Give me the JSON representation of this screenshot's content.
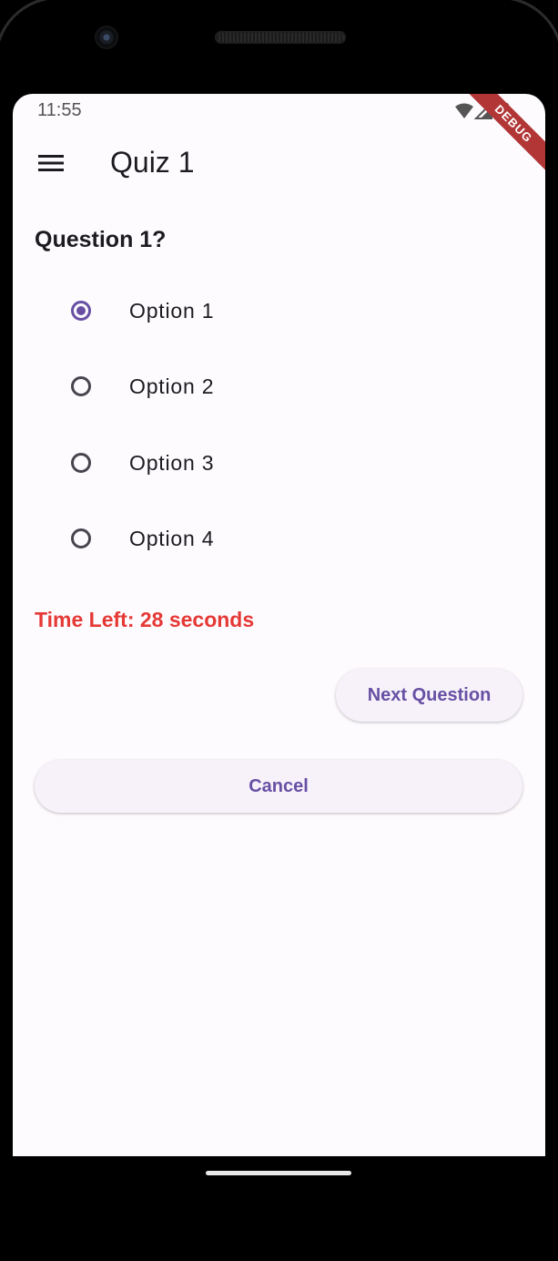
{
  "status_bar": {
    "time": "11:55",
    "icons": [
      "wifi-icon",
      "cell-signal-icon",
      "battery-icon"
    ],
    "debug_label": "DEBUG"
  },
  "app_bar": {
    "title": "Quiz 1",
    "menu_icon": "menu-icon"
  },
  "quiz": {
    "question": "Question 1?",
    "options": [
      {
        "label": "Option 1",
        "selected": true
      },
      {
        "label": "Option 2",
        "selected": false
      },
      {
        "label": "Option 3",
        "selected": false
      },
      {
        "label": "Option 4",
        "selected": false
      }
    ],
    "time_left": "Time Left: 28 seconds"
  },
  "actions": {
    "next_label": "Next Question",
    "cancel_label": "Cancel"
  },
  "colors": {
    "primary": "#6750a4",
    "timer": "#e53935",
    "debug_banner": "#b23636",
    "surface": "#fefbff"
  }
}
